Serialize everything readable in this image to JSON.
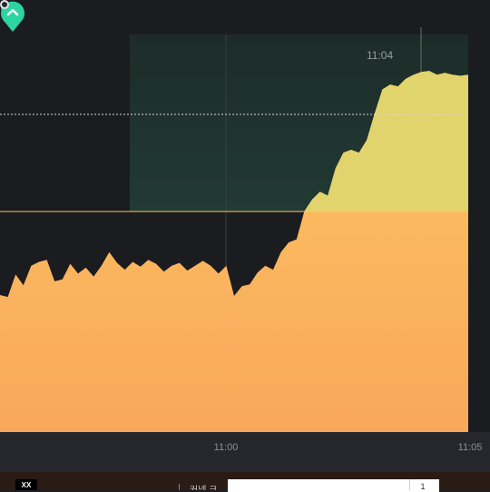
{
  "chart_data": {
    "type": "area",
    "title": "",
    "xlabel": "",
    "ylabel": "",
    "tick_labels": [
      "11:00",
      "11:05"
    ],
    "lock_time": "11:04",
    "series": [
      {
        "color": "#fdc25e",
        "x": [
          "10:55:00",
          "10:55:10",
          "10:55:20",
          "10:55:30",
          "10:55:40",
          "10:55:50",
          "10:56:00",
          "10:56:10",
          "10:56:20",
          "10:56:30",
          "10:56:40",
          "10:56:50",
          "10:57:00",
          "10:57:10",
          "10:57:20",
          "10:57:30",
          "10:57:40",
          "10:57:50",
          "10:58:00",
          "10:58:10",
          "10:58:20",
          "10:58:30",
          "10:58:40",
          "10:58:50",
          "10:59:00",
          "10:59:10",
          "10:59:20",
          "10:59:30",
          "10:59:40",
          "10:59:50",
          "11:00:00",
          "11:00:10",
          "11:00:20",
          "11:00:30",
          "11:00:40",
          "11:00:50",
          "11:01:00",
          "11:01:10",
          "11:01:20",
          "11:01:30",
          "11:01:40",
          "11:01:50",
          "11:02:00",
          "11:02:10",
          "11:02:20",
          "11:02:30",
          "11:02:40",
          "11:02:50",
          "11:03:00",
          "11:03:10",
          "11:03:20",
          "11:03:30",
          "11:03:40",
          "11:03:50",
          "11:04:00",
          "11:04:10",
          "11:04:20",
          "11:04:30",
          "11:04:40",
          "11:04:50",
          "11:05:00"
        ],
        "y": [
          0.14,
          0.12,
          0.35,
          0.24,
          0.44,
          0.48,
          0.5,
          0.28,
          0.3,
          0.46,
          0.36,
          0.42,
          0.33,
          0.44,
          0.58,
          0.47,
          0.4,
          0.48,
          0.43,
          0.5,
          0.46,
          0.38,
          0.44,
          0.47,
          0.39,
          0.44,
          0.49,
          0.44,
          0.36,
          0.44,
          0.13,
          0.23,
          0.25,
          0.37,
          0.44,
          0.4,
          0.58,
          0.68,
          0.71,
          1.0,
          1.12,
          1.2,
          1.16,
          1.44,
          1.6,
          1.63,
          1.6,
          1.73,
          2.0,
          2.25,
          2.3,
          2.28,
          2.36,
          2.4,
          2.43,
          2.44,
          2.4,
          2.42,
          2.4,
          2.39,
          2.4
        ]
      }
    ],
    "open_value": 0.5,
    "reference_value": 2.4,
    "ylim": [
      0,
      3
    ],
    "grid": true,
    "legend": "none"
  },
  "icons": {
    "deal": "chevron-up-icon",
    "lock": "lock-icon",
    "current": "current-point-icon"
  },
  "colors": {
    "background": "#1b1c20",
    "area_top": "#fdc561",
    "area_bottom": "#f9a75c",
    "profit_zone": "#213a33",
    "profit_area": "#e2d46c",
    "deal_marker": "#2ed3a2",
    "lock": "#f0454e"
  },
  "taskbar": {
    "app_icon_label": "XX",
    "text": "커넥 크",
    "input_value": "",
    "button_label": "1"
  }
}
